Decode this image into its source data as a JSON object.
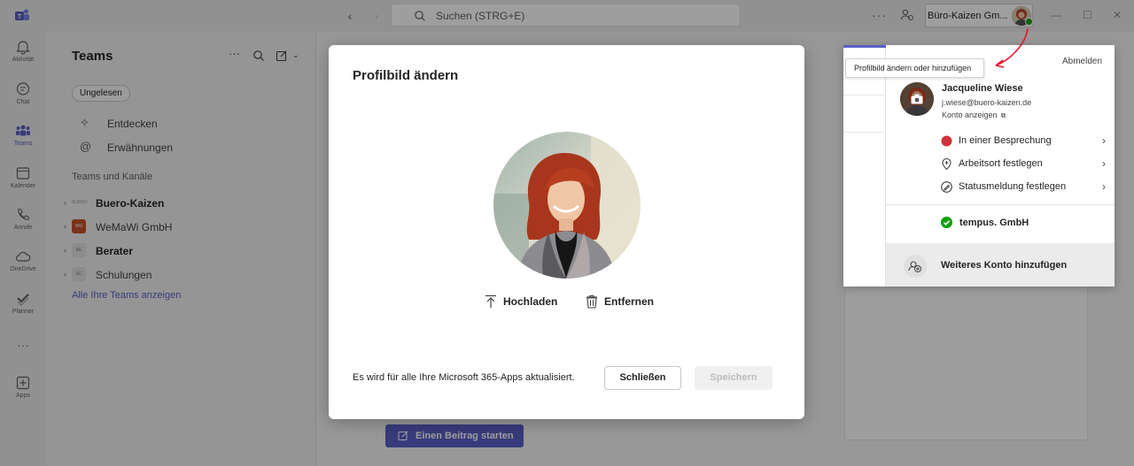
{
  "titlebar": {
    "search_placeholder": "Suchen (STRG+E)",
    "more": "···",
    "account_name": "Büro-Kaizen Gm..."
  },
  "rail": [
    {
      "label": "Aktivität",
      "icon": "bell-icon"
    },
    {
      "label": "Chat",
      "icon": "chat-icon"
    },
    {
      "label": "Teams",
      "icon": "teams-icon"
    },
    {
      "label": "Kalender",
      "icon": "calendar-icon"
    },
    {
      "label": "Anrufe",
      "icon": "phone-icon"
    },
    {
      "label": "OneDrive",
      "icon": "cloud-icon"
    },
    {
      "label": "Planner",
      "icon": "planner-icon"
    },
    {
      "label": "···",
      "icon": "more-icon"
    },
    {
      "label": "Apps",
      "icon": "apps-icon"
    }
  ],
  "teams_panel": {
    "title": "Teams",
    "filter": "Ungelesen",
    "discover": "Entdecken",
    "mentions": "Erwähnungen",
    "section": "Teams und Kanäle",
    "teams": [
      {
        "name": "Buero-Kaizen",
        "badge": "BUERO",
        "bold": true,
        "color": "#f0f0f0"
      },
      {
        "name": "WeMaWi GmbH",
        "badge": "WG",
        "bold": false,
        "color": "#c4512a"
      },
      {
        "name": "Berater",
        "badge": "BE",
        "bold": true,
        "color": "#e8e8e8"
      },
      {
        "name": "Schulungen",
        "badge": "SC",
        "bold": false,
        "color": "#e8e8e8"
      }
    ],
    "all_teams": "Alle Ihre Teams anzeigen"
  },
  "main": {
    "start_post": "Einen Beitrag starten"
  },
  "dialog": {
    "title": "Profilbild ändern",
    "upload": "Hochladen",
    "remove": "Entfernen",
    "note": "Es wird für alle Ihre Microsoft 365-Apps aktualisiert.",
    "close": "Schließen",
    "save": "Speichern"
  },
  "flyout": {
    "tooltip": "Profilbild ändern oder hinzufügen",
    "signout": "Abmelden",
    "name": "Jacqueline Wiese",
    "email": "j.wiese@buero-kaizen.de",
    "view_account": "Konto anzeigen",
    "items": [
      {
        "label": "In einer Besprechung",
        "icon": "status-busy-icon"
      },
      {
        "label": "Arbeitsort festlegen",
        "icon": "location-icon"
      },
      {
        "label": "Statusmeldung festlegen",
        "icon": "status-message-icon"
      }
    ],
    "org": "tempus. GmbH",
    "add_account": "Weiteres Konto hinzufügen"
  },
  "colors": {
    "accent": "#5b5fc7",
    "busy": "#d13438",
    "available": "#13a10e"
  }
}
